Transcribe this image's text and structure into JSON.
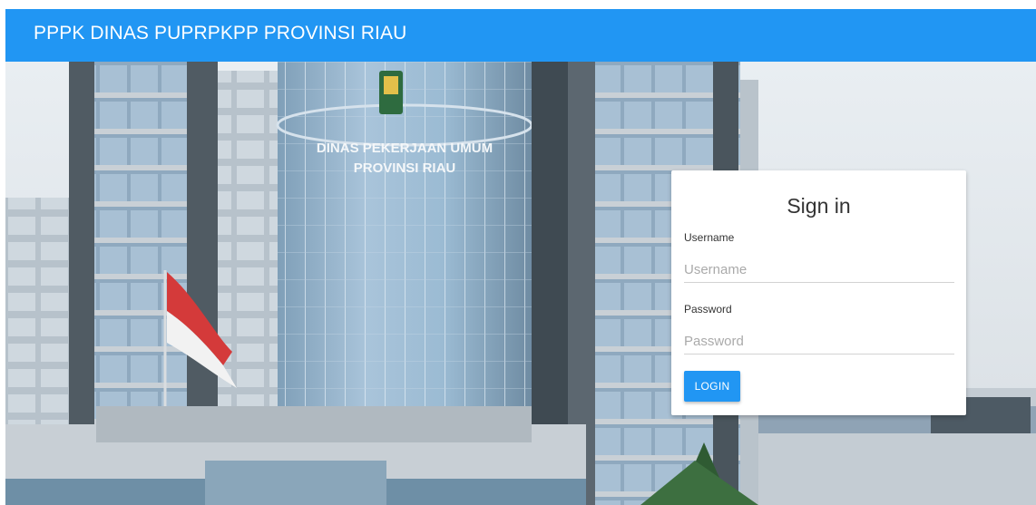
{
  "navbar": {
    "brand": "PPPK DINAS PUPRPKPP PROVINSI RIAU",
    "color": "#2196f3"
  },
  "hero": {
    "building_sign_line1": "DINAS PEKERJAAN UMUM",
    "building_sign_line2": "PROVINSI RIAU"
  },
  "login": {
    "title": "Sign in",
    "username_label": "Username",
    "username_placeholder": "Username",
    "username_value": "",
    "password_label": "Password",
    "password_placeholder": "Password",
    "password_value": "",
    "button_label": "LOGIN",
    "button_color": "#2196f3"
  }
}
